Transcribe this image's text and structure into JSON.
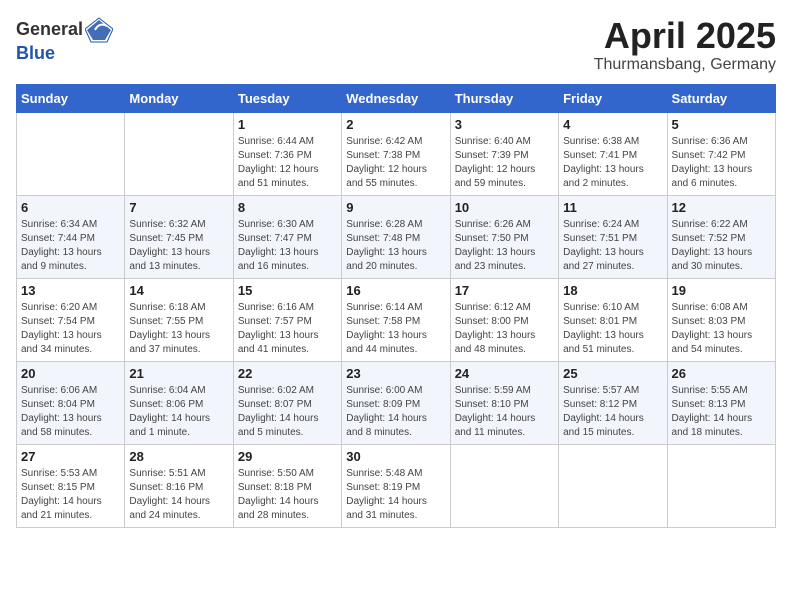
{
  "header": {
    "logo_general": "General",
    "logo_blue": "Blue",
    "month_title": "April 2025",
    "location": "Thurmansbang, Germany"
  },
  "days_of_week": [
    "Sunday",
    "Monday",
    "Tuesday",
    "Wednesday",
    "Thursday",
    "Friday",
    "Saturday"
  ],
  "weeks": [
    [
      {
        "day": "",
        "detail": ""
      },
      {
        "day": "",
        "detail": ""
      },
      {
        "day": "1",
        "detail": "Sunrise: 6:44 AM\nSunset: 7:36 PM\nDaylight: 12 hours and 51 minutes."
      },
      {
        "day": "2",
        "detail": "Sunrise: 6:42 AM\nSunset: 7:38 PM\nDaylight: 12 hours and 55 minutes."
      },
      {
        "day": "3",
        "detail": "Sunrise: 6:40 AM\nSunset: 7:39 PM\nDaylight: 12 hours and 59 minutes."
      },
      {
        "day": "4",
        "detail": "Sunrise: 6:38 AM\nSunset: 7:41 PM\nDaylight: 13 hours and 2 minutes."
      },
      {
        "day": "5",
        "detail": "Sunrise: 6:36 AM\nSunset: 7:42 PM\nDaylight: 13 hours and 6 minutes."
      }
    ],
    [
      {
        "day": "6",
        "detail": "Sunrise: 6:34 AM\nSunset: 7:44 PM\nDaylight: 13 hours and 9 minutes."
      },
      {
        "day": "7",
        "detail": "Sunrise: 6:32 AM\nSunset: 7:45 PM\nDaylight: 13 hours and 13 minutes."
      },
      {
        "day": "8",
        "detail": "Sunrise: 6:30 AM\nSunset: 7:47 PM\nDaylight: 13 hours and 16 minutes."
      },
      {
        "day": "9",
        "detail": "Sunrise: 6:28 AM\nSunset: 7:48 PM\nDaylight: 13 hours and 20 minutes."
      },
      {
        "day": "10",
        "detail": "Sunrise: 6:26 AM\nSunset: 7:50 PM\nDaylight: 13 hours and 23 minutes."
      },
      {
        "day": "11",
        "detail": "Sunrise: 6:24 AM\nSunset: 7:51 PM\nDaylight: 13 hours and 27 minutes."
      },
      {
        "day": "12",
        "detail": "Sunrise: 6:22 AM\nSunset: 7:52 PM\nDaylight: 13 hours and 30 minutes."
      }
    ],
    [
      {
        "day": "13",
        "detail": "Sunrise: 6:20 AM\nSunset: 7:54 PM\nDaylight: 13 hours and 34 minutes."
      },
      {
        "day": "14",
        "detail": "Sunrise: 6:18 AM\nSunset: 7:55 PM\nDaylight: 13 hours and 37 minutes."
      },
      {
        "day": "15",
        "detail": "Sunrise: 6:16 AM\nSunset: 7:57 PM\nDaylight: 13 hours and 41 minutes."
      },
      {
        "day": "16",
        "detail": "Sunrise: 6:14 AM\nSunset: 7:58 PM\nDaylight: 13 hours and 44 minutes."
      },
      {
        "day": "17",
        "detail": "Sunrise: 6:12 AM\nSunset: 8:00 PM\nDaylight: 13 hours and 48 minutes."
      },
      {
        "day": "18",
        "detail": "Sunrise: 6:10 AM\nSunset: 8:01 PM\nDaylight: 13 hours and 51 minutes."
      },
      {
        "day": "19",
        "detail": "Sunrise: 6:08 AM\nSunset: 8:03 PM\nDaylight: 13 hours and 54 minutes."
      }
    ],
    [
      {
        "day": "20",
        "detail": "Sunrise: 6:06 AM\nSunset: 8:04 PM\nDaylight: 13 hours and 58 minutes."
      },
      {
        "day": "21",
        "detail": "Sunrise: 6:04 AM\nSunset: 8:06 PM\nDaylight: 14 hours and 1 minute."
      },
      {
        "day": "22",
        "detail": "Sunrise: 6:02 AM\nSunset: 8:07 PM\nDaylight: 14 hours and 5 minutes."
      },
      {
        "day": "23",
        "detail": "Sunrise: 6:00 AM\nSunset: 8:09 PM\nDaylight: 14 hours and 8 minutes."
      },
      {
        "day": "24",
        "detail": "Sunrise: 5:59 AM\nSunset: 8:10 PM\nDaylight: 14 hours and 11 minutes."
      },
      {
        "day": "25",
        "detail": "Sunrise: 5:57 AM\nSunset: 8:12 PM\nDaylight: 14 hours and 15 minutes."
      },
      {
        "day": "26",
        "detail": "Sunrise: 5:55 AM\nSunset: 8:13 PM\nDaylight: 14 hours and 18 minutes."
      }
    ],
    [
      {
        "day": "27",
        "detail": "Sunrise: 5:53 AM\nSunset: 8:15 PM\nDaylight: 14 hours and 21 minutes."
      },
      {
        "day": "28",
        "detail": "Sunrise: 5:51 AM\nSunset: 8:16 PM\nDaylight: 14 hours and 24 minutes."
      },
      {
        "day": "29",
        "detail": "Sunrise: 5:50 AM\nSunset: 8:18 PM\nDaylight: 14 hours and 28 minutes."
      },
      {
        "day": "30",
        "detail": "Sunrise: 5:48 AM\nSunset: 8:19 PM\nDaylight: 14 hours and 31 minutes."
      },
      {
        "day": "",
        "detail": ""
      },
      {
        "day": "",
        "detail": ""
      },
      {
        "day": "",
        "detail": ""
      }
    ]
  ]
}
